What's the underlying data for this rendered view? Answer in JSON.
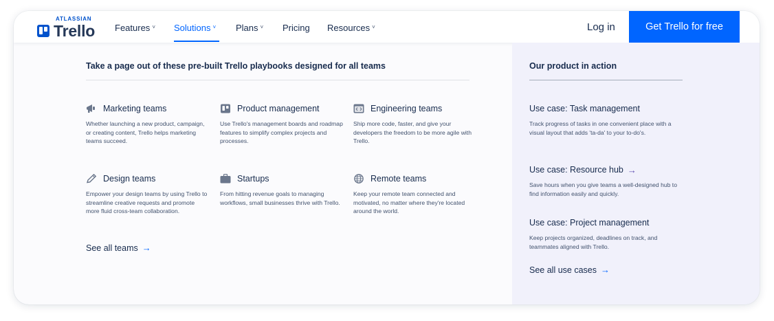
{
  "header": {
    "logo_brand": "ATLASSIAN",
    "logo_name": "Trello",
    "nav": [
      {
        "label": "Features",
        "chevron": true,
        "active": false
      },
      {
        "label": "Solutions",
        "chevron": true,
        "active": true
      },
      {
        "label": "Plans",
        "chevron": true,
        "active": false
      },
      {
        "label": "Pricing",
        "chevron": false,
        "active": false
      },
      {
        "label": "Resources",
        "chevron": true,
        "active": false
      }
    ],
    "login_label": "Log in",
    "cta_label": "Get Trello for free",
    "chevron_glyph": "˅"
  },
  "playbooks": {
    "intro": "Take a page out of these pre-built Trello playbooks designed for all teams",
    "cards": [
      {
        "icon": "megaphone-icon",
        "title": "Marketing teams",
        "desc": "Whether launching a new product, campaign, or creating content, Trello helps marketing teams succeed."
      },
      {
        "icon": "board-icon",
        "title": "Product management",
        "desc": "Use Trello's management boards and roadmap features to simplify complex projects and processes."
      },
      {
        "icon": "code-window-icon",
        "title": "Engineering teams",
        "desc": "Ship more code, faster, and give your developers the freedom to be more agile with Trello."
      },
      {
        "icon": "pencil-icon",
        "title": "Design teams",
        "desc": "Empower your design teams by using Trello to streamline creative requests and promote more fluid cross-team collaboration."
      },
      {
        "icon": "briefcase-icon",
        "title": "Startups",
        "desc": "From hitting revenue goals to managing workflows, small businesses thrive with Trello."
      },
      {
        "icon": "globe-icon",
        "title": "Remote teams",
        "desc": "Keep your remote team connected and motivated, no matter where they're located around the world."
      }
    ],
    "see_all_label": "See all teams"
  },
  "product_in_action": {
    "title": "Our product in action",
    "use_cases": [
      {
        "title": "Use case: Task management",
        "desc": "Track progress of tasks in one convenient place with a visual layout that adds 'ta-da' to your to-do's.",
        "arrow": false
      },
      {
        "title": "Use case: Resource hub",
        "desc": "Save hours when you give teams a well-designed hub to find information easily and quickly.",
        "arrow": true
      },
      {
        "title": "Use case: Project management",
        "desc": "Keep projects organized, deadlines on track, and teammates aligned with Trello.",
        "arrow": false
      }
    ],
    "see_all_label": "See all use cases"
  },
  "arrow_glyph": "→",
  "colors": {
    "brand_blue": "#0065ff",
    "logo_blue": "#0052cc",
    "text_dark": "#172b4d",
    "text_muted": "#42526e",
    "side_panel_bg": "#f1f1fb",
    "arrow_purple": "#5e4db2",
    "icon_gray": "#6b778c"
  }
}
